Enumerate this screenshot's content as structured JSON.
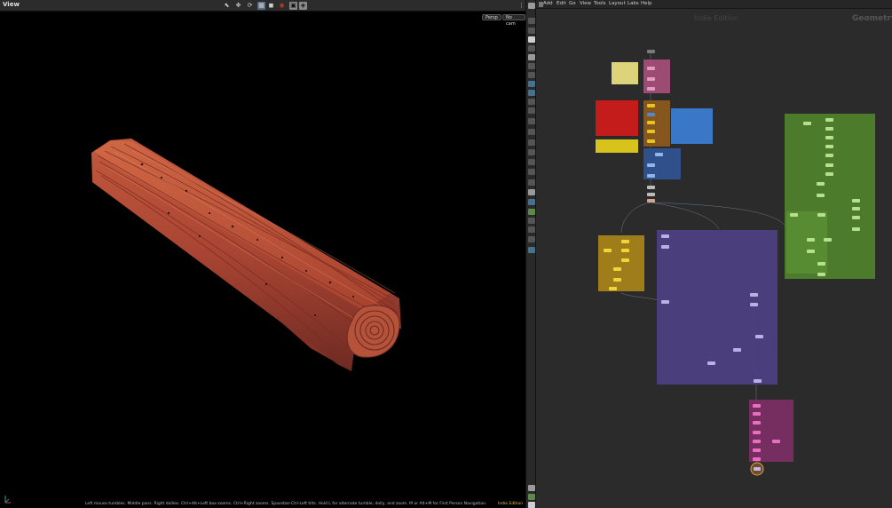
{
  "viewport": {
    "title": "View",
    "camera_label": "Persp",
    "cam_label": "No cam",
    "status_text": "Left mouse tumbles. Middle pans. Right dollies. Ctrl+Alt+Left box-zooms. Ctrl+Right zooms. Spacebar-Ctrl-Left tilts. Hold L for alternate tumble, dolly, and zoom.    M or Alt+M for First Person Navigation.",
    "indie_label": "Indie Edition"
  },
  "network": {
    "menu": [
      "Add",
      "Edit",
      "Go",
      "View",
      "Tools",
      "Layout",
      "Labs",
      "Help"
    ],
    "watermark": "Indie Edition",
    "context": "Geometry"
  },
  "colors": {
    "pink": "#d46fa4",
    "yellow": "#e6c41a",
    "blue": "#3e6fb8",
    "green": "#4f7f2c",
    "purple": "#4d3f82",
    "gold": "#a7821a",
    "wood": "#a34332"
  }
}
